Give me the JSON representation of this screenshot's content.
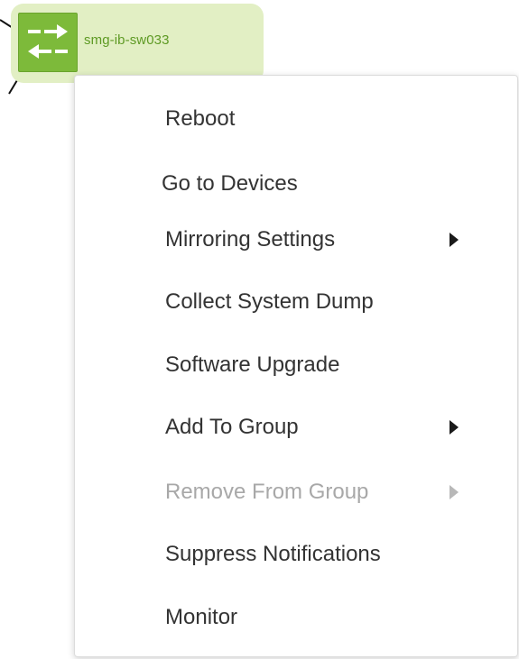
{
  "node": {
    "name": "smg-ib-sw033",
    "icon": "switch-icon",
    "color": "#7dba3a",
    "highlight_color": "#e2efc4"
  },
  "context_menu": {
    "items": [
      {
        "label": "Reboot",
        "has_submenu": false,
        "enabled": true
      },
      {
        "label": "Go to Devices",
        "has_submenu": false,
        "enabled": true
      },
      {
        "label": "Mirroring Settings",
        "has_submenu": true,
        "enabled": true
      },
      {
        "label": "Collect System Dump",
        "has_submenu": false,
        "enabled": true
      },
      {
        "label": "Software Upgrade",
        "has_submenu": false,
        "enabled": true
      },
      {
        "label": "Add To Group",
        "has_submenu": true,
        "enabled": true
      },
      {
        "label": "Remove From Group",
        "has_submenu": true,
        "enabled": false
      },
      {
        "label": "Suppress Notifications",
        "has_submenu": false,
        "enabled": true
      },
      {
        "label": "Monitor",
        "has_submenu": false,
        "enabled": true
      }
    ]
  }
}
